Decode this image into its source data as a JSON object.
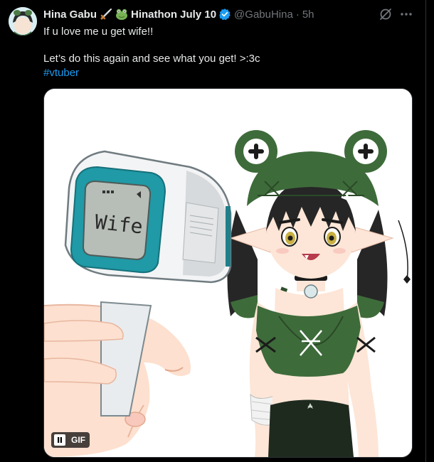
{
  "author": {
    "display_name": "Hina Gabu",
    "event_name": "Hinathon July 10",
    "handle": "@GabuHina",
    "time": "5h"
  },
  "tweet": {
    "line1": "If u love me u get wife!!",
    "line2": "Let’s do this again and see what you get! >:3c",
    "hashtag": "#vtuber"
  },
  "media": {
    "thermometer_readout": "Wife",
    "gif_label": "GIF"
  },
  "icons": {
    "verified": "verified-badge-icon",
    "grok": "grok-icon",
    "more": "more-icon",
    "pause": "pause-icon",
    "sword_emoji": "sword-emoji-icon",
    "frog_emoji": "frog-emoji-icon"
  },
  "colors": {
    "background": "#000000",
    "text": "#e7e9ea",
    "muted": "#71767b",
    "link": "#1d9bf0",
    "verified": "#1d9bf0",
    "hair_green": "#3e6b3a"
  }
}
